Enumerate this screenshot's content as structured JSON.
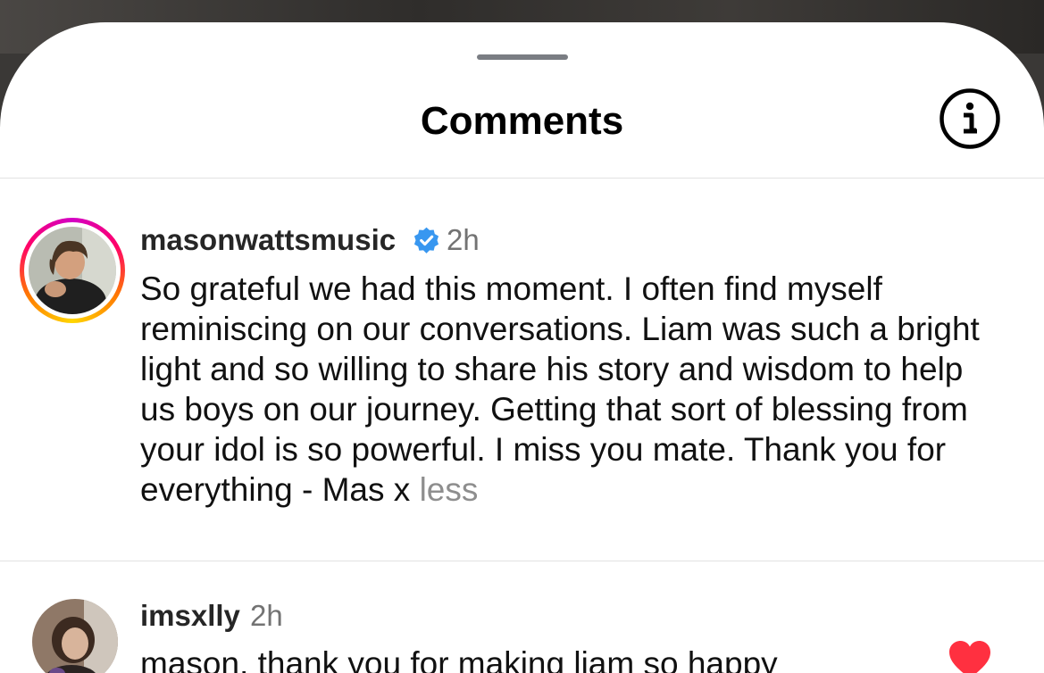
{
  "header": {
    "title": "Comments",
    "info_icon": "info-circle-icon"
  },
  "comments": [
    {
      "username": "masonwattsmusic",
      "verified": true,
      "time": "2h",
      "text": "So grateful we had this moment. I often find myself reminiscing on our conversations. Liam was such a bright light and so willing to share his story and wisdom to help us boys on our journey. Getting that sort of blessing from your idol is so powerful. I miss you mate. Thank you for everything - Mas x",
      "toggle_label": "less",
      "has_story_ring": true
    },
    {
      "username": "imsxlly",
      "verified": false,
      "time": "2h",
      "text": "mason, thank you for making liam so happy",
      "liked": true,
      "like_icon": "heart-filled-icon"
    }
  ],
  "colors": {
    "verified_blue": "#3897f0",
    "like_red": "#ff3040",
    "muted_text": "#737373"
  }
}
